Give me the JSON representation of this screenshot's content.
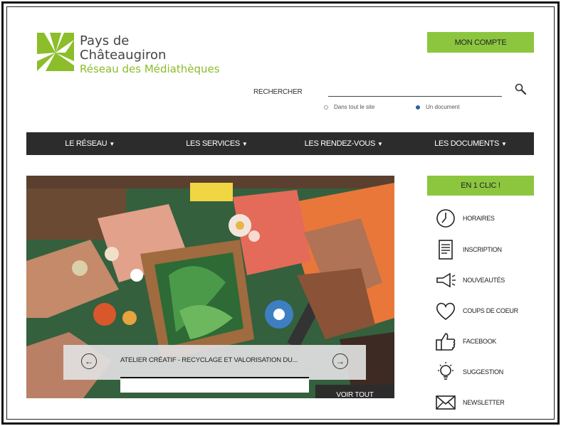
{
  "logo": {
    "line1": "Pays de",
    "line2": "Châteaugiron",
    "line3": "Réseau des Médiathèques"
  },
  "header": {
    "account_label": "MON COMPTE"
  },
  "search": {
    "label": "RECHERCHER",
    "placeholder": "",
    "options": [
      {
        "label": "Dans tout le site",
        "selected": false
      },
      {
        "label": "Un document",
        "selected": true
      }
    ]
  },
  "nav": {
    "items": [
      {
        "label": "LE RÉSEAU"
      },
      {
        "label": "LES SERVICES"
      },
      {
        "label": "LES RENDEZ-VOUS"
      },
      {
        "label": "LES DOCUMENTS"
      }
    ]
  },
  "hero": {
    "caption": "ATELIER CRÉATIF - RECYCLAGE ET VALORISATION DU...",
    "see_all": "VOIR TOUT"
  },
  "quick_links": {
    "title": "EN 1 CLIC !",
    "items": [
      {
        "label": "HORAIRES",
        "icon": "clock-icon"
      },
      {
        "label": "INSCRIPTION",
        "icon": "form-icon"
      },
      {
        "label": "NOUVEAUTÉS",
        "icon": "megaphone-icon"
      },
      {
        "label": "COUPS DE COEUR",
        "icon": "heart-icon"
      },
      {
        "label": "FACEBOOK",
        "icon": "thumbs-up-icon"
      },
      {
        "label": "SUGGESTION",
        "icon": "lightbulb-icon"
      },
      {
        "label": "NEWSLETTER",
        "icon": "envelope-icon"
      }
    ]
  },
  "colors": {
    "brand_green": "#8cc63f",
    "logo_green": "#8cbd2a",
    "nav_dark": "#2c2c2c"
  }
}
